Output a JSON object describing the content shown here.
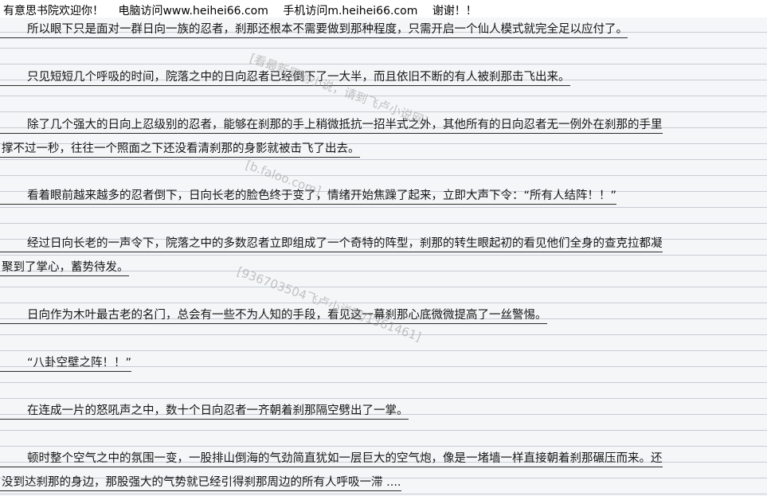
{
  "header": {
    "part1": "有意思书院欢迎你！",
    "part2": "电脑访问www.heihei66.com",
    "part3": "手机访问m.heihei66.com",
    "part4": "谢谢！！"
  },
  "lines": [
    "所以眼下只是面对一群日向一族的忍者，刹那还根本不需要做到那种程度，只需开启一个仙人模式就完全足以应付了。",
    "只见短短几个呼吸的时间，院落之中的日向忍者已经倒下了一大半，而且依旧不断的有人被刹那击飞出来。",
    "除了几个强大的日向上忍级别的忍者，能够在刹那的手上稍微抵抗一招半式之外，其他所有的日向忍者无一例外在刹那的手里",
    "撑不过一秒，往往一个照面之下还没看清刹那的身影就被击飞了出去。",
    "看着眼前越来越多的忍者倒下，日向长老的脸色终于变了，情绪开始焦躁了起来，立即大声下令：“所有人结阵！！”",
    "经过日向长老的一声令下，院落之中的多数忍者立即组成了一个奇特的阵型，刹那的转生眼起初的看见他们全身的查克拉都凝",
    "聚到了掌心，蓄势待发。",
    "日向作为木叶最古老的名门，总会有一些不为人知的手段，看见这一幕刹那心底微微提高了一丝警惕。",
    "“八卦空壁之阵！！”",
    "在连成一片的怒吼声之中，数十个日向忍者一齐朝着刹那隔空劈出了一掌。",
    "顿时整个空气之中的氛围一变，一股排山倒海的气劲简直犹如一层巨大的空气炮，像是一堵墙一样直接朝着刹那碾压而来。还",
    "没到达刹那的身边，那股强大的气势就已经引得刹那周边的所有人呼吸一滞 ...."
  ],
  "watermark": {
    "w1": "[看最新原创小说，请到飞卢小说网]",
    "w2": "[b.faloo.com]",
    "w3": "[936703504飞卢小说网/1361461]"
  }
}
